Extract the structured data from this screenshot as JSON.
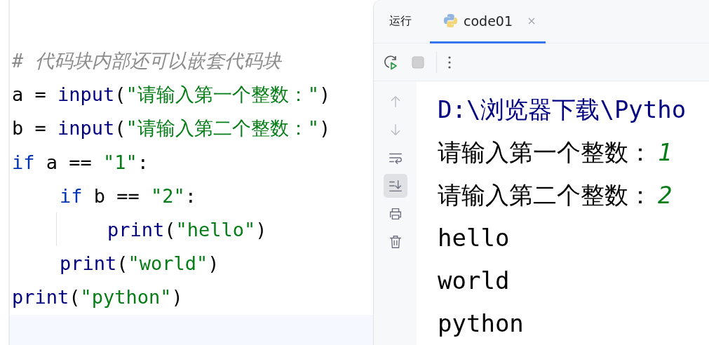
{
  "editor": {
    "lines": [
      {
        "tokens": [
          {
            "text": "# 代码块内部还可以嵌套代码块",
            "kind": "comment"
          }
        ]
      },
      {
        "tokens": [
          {
            "text": "a = ",
            "kind": "plain"
          },
          {
            "text": "input",
            "kind": "builtin"
          },
          {
            "text": "(",
            "kind": "plain"
          },
          {
            "text": "\"请输入第一个整数：\"",
            "kind": "string"
          },
          {
            "text": ")",
            "kind": "plain"
          }
        ]
      },
      {
        "tokens": [
          {
            "text": "b = ",
            "kind": "plain"
          },
          {
            "text": "input",
            "kind": "builtin"
          },
          {
            "text": "(",
            "kind": "plain"
          },
          {
            "text": "\"请输入第二个整数：\"",
            "kind": "string"
          },
          {
            "text": ")",
            "kind": "plain"
          }
        ]
      },
      {
        "tokens": [
          {
            "text": "if",
            "kind": "keyword"
          },
          {
            "text": " a == ",
            "kind": "plain"
          },
          {
            "text": "\"1\"",
            "kind": "string"
          },
          {
            "text": ":",
            "kind": "plain"
          }
        ],
        "children": [
          {
            "tokens": [
              {
                "text": "if",
                "kind": "keyword"
              },
              {
                "text": " b == ",
                "kind": "plain"
              },
              {
                "text": "\"2\"",
                "kind": "string"
              },
              {
                "text": ":",
                "kind": "plain"
              }
            ],
            "children": [
              {
                "tokens": [
                  {
                    "text": "print",
                    "kind": "builtin"
                  },
                  {
                    "text": "(",
                    "kind": "plain"
                  },
                  {
                    "text": "\"hello\"",
                    "kind": "string"
                  },
                  {
                    "text": ")",
                    "kind": "plain"
                  }
                ]
              }
            ]
          },
          {
            "tokens": [
              {
                "text": "print",
                "kind": "builtin"
              },
              {
                "text": "(",
                "kind": "plain"
              },
              {
                "text": "\"world\"",
                "kind": "string"
              },
              {
                "text": ")",
                "kind": "plain"
              }
            ]
          }
        ]
      },
      {
        "tokens": [
          {
            "text": "print",
            "kind": "builtin"
          },
          {
            "text": "(",
            "kind": "plain"
          },
          {
            "text": "\"python\"",
            "kind": "string"
          },
          {
            "text": ")",
            "kind": "plain"
          }
        ]
      }
    ]
  },
  "run_panel": {
    "title": "运行",
    "tabs": [
      {
        "label": "code01",
        "selected": true,
        "closable": true
      }
    ],
    "gutter_tools": [
      {
        "kind": "up",
        "disabled": true,
        "selected": false
      },
      {
        "kind": "down",
        "disabled": true,
        "selected": false
      },
      {
        "kind": "wrap",
        "disabled": false,
        "selected": false
      },
      {
        "kind": "scroll-end",
        "disabled": false,
        "selected": true
      },
      {
        "kind": "print",
        "disabled": false,
        "selected": false
      },
      {
        "kind": "clear",
        "disabled": false,
        "selected": false
      }
    ],
    "console": [
      {
        "kind": "path",
        "text": "D:\\浏览器下载\\Pytho"
      },
      {
        "kind": "prompt",
        "text": "请输入第一个整数：",
        "input": "1"
      },
      {
        "kind": "prompt",
        "text": "请输入第二个整数：",
        "input": "2"
      },
      {
        "kind": "output",
        "text": "hello"
      },
      {
        "kind": "output",
        "text": "world"
      },
      {
        "kind": "output",
        "text": "python"
      }
    ]
  }
}
